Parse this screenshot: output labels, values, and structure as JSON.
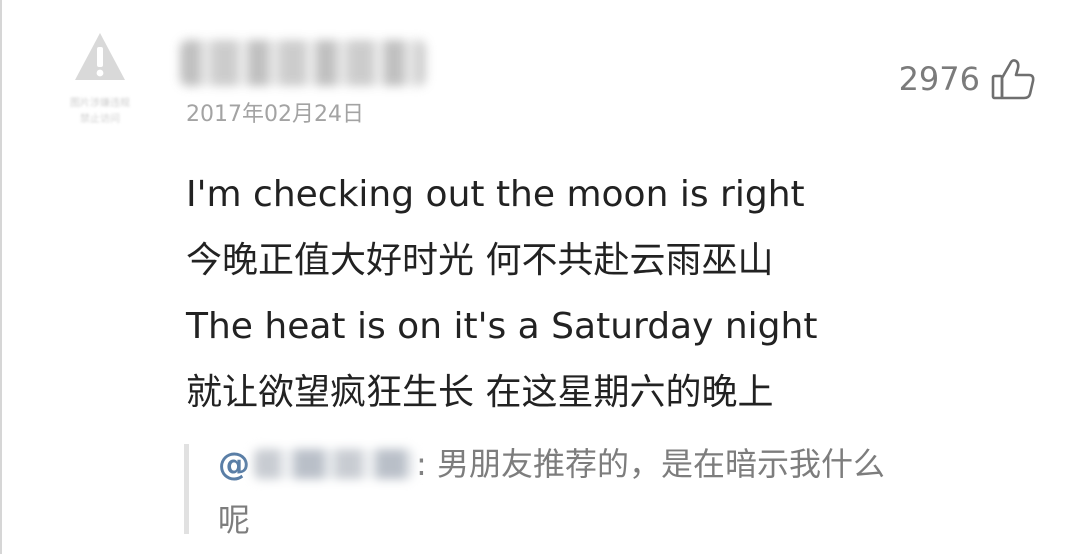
{
  "comment": {
    "avatar": {
      "icon": "warning-icon",
      "caption_lines": [
        "图片涉嫌违规",
        "禁止访问"
      ]
    },
    "username": "",
    "date": "2017年02月24日",
    "likes": {
      "count": "2976",
      "icon": "thumbs-up-icon"
    },
    "lines": [
      "I'm checking out the moon is right",
      "今晚正值大好时光 何不共赴云雨巫山",
      "The heat is on it's a Saturday night",
      "就让欲望疯狂生长 在这星期六的晚上"
    ],
    "reply": {
      "at": "@",
      "mention": "",
      "text_line1": ": 男朋友推荐的，是在暗示我什么",
      "text_line2": "呢"
    }
  },
  "colors": {
    "text_primary": "#222222",
    "text_secondary": "#a3a3a3",
    "like_count": "#7b7b7b",
    "reply_text": "#7d7d7d",
    "mention_accent": "#5a7ea6"
  }
}
